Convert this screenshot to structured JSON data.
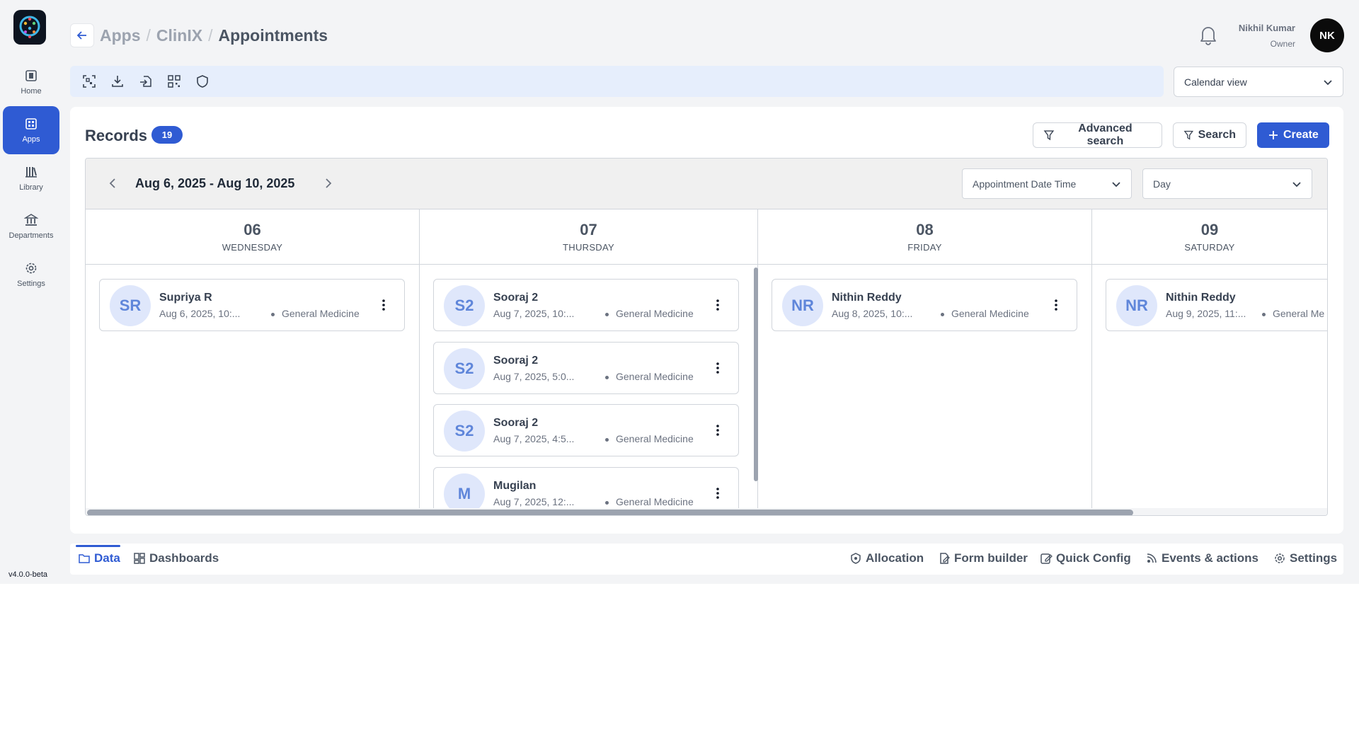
{
  "sidebar": {
    "items": [
      {
        "label": "Home",
        "icon": "home-icon"
      },
      {
        "label": "Apps",
        "icon": "apps-icon"
      },
      {
        "label": "Library",
        "icon": "library-icon"
      },
      {
        "label": "Departments",
        "icon": "departments-icon"
      },
      {
        "label": "Settings",
        "icon": "settings-icon"
      }
    ],
    "active": "Apps",
    "version": "v4.0.0-beta"
  },
  "header": {
    "breadcrumb": [
      "Apps",
      "ClinIX",
      "Appointments"
    ],
    "separator": "/",
    "user_name": "Nikhil Kumar",
    "user_role": "Owner",
    "avatar_initials": "NK"
  },
  "toolbar": {
    "icons": [
      "scan-icon",
      "download-icon",
      "import-icon",
      "qr-code-icon",
      "shield-icon"
    ],
    "view_select": "Calendar view"
  },
  "records": {
    "title": "Records",
    "count": "19",
    "advanced_search": "Advanced search",
    "search": "Search",
    "create": "Create"
  },
  "calendar": {
    "date_range": "Aug 6, 2025 - Aug 10, 2025",
    "field_select": "Appointment Date Time",
    "mode_select": "Day",
    "days": [
      {
        "num": "06",
        "name": "WEDNESDAY"
      },
      {
        "num": "07",
        "name": "THURSDAY"
      },
      {
        "num": "08",
        "name": "FRIDAY"
      },
      {
        "num": "09",
        "name": "SATURDAY"
      }
    ],
    "appointments": [
      {
        "initials": "SR",
        "name": "Supriya R",
        "date": "Aug 6, 2025, 10:...",
        "dept": "General Medicine"
      },
      {
        "initials": "S2",
        "name": "Sooraj 2",
        "date": "Aug 7, 2025, 10:...",
        "dept": "General Medicine"
      },
      {
        "initials": "S2",
        "name": "Sooraj 2",
        "date": "Aug 7, 2025, 5:0...",
        "dept": "General Medicine"
      },
      {
        "initials": "S2",
        "name": "Sooraj 2",
        "date": "Aug 7, 2025, 4:5...",
        "dept": "General Medicine"
      },
      {
        "initials": "M",
        "name": "Mugilan",
        "date": "Aug 7, 2025, 12:...",
        "dept": "General Medicine"
      },
      {
        "initials": "NR",
        "name": "Nithin Reddy",
        "date": "Aug 8, 2025, 10:...",
        "dept": "General Medicine"
      },
      {
        "initials": "NR",
        "name": "Nithin Reddy",
        "date": "Aug 9, 2025, 11:...",
        "dept": "General Me"
      }
    ]
  },
  "bottom": {
    "left_tabs": [
      {
        "label": "Data"
      },
      {
        "label": "Dashboards"
      }
    ],
    "right_tabs": [
      {
        "label": "Allocation"
      },
      {
        "label": "Form builder"
      },
      {
        "label": "Quick Config"
      },
      {
        "label": "Events & actions"
      },
      {
        "label": "Settings"
      }
    ]
  },
  "colors": {
    "accent": "#2f5bd3",
    "avatar_bg": "#dfe7fb",
    "avatar_text": "#5f86da",
    "toolbar_bg": "#e6eefc"
  }
}
